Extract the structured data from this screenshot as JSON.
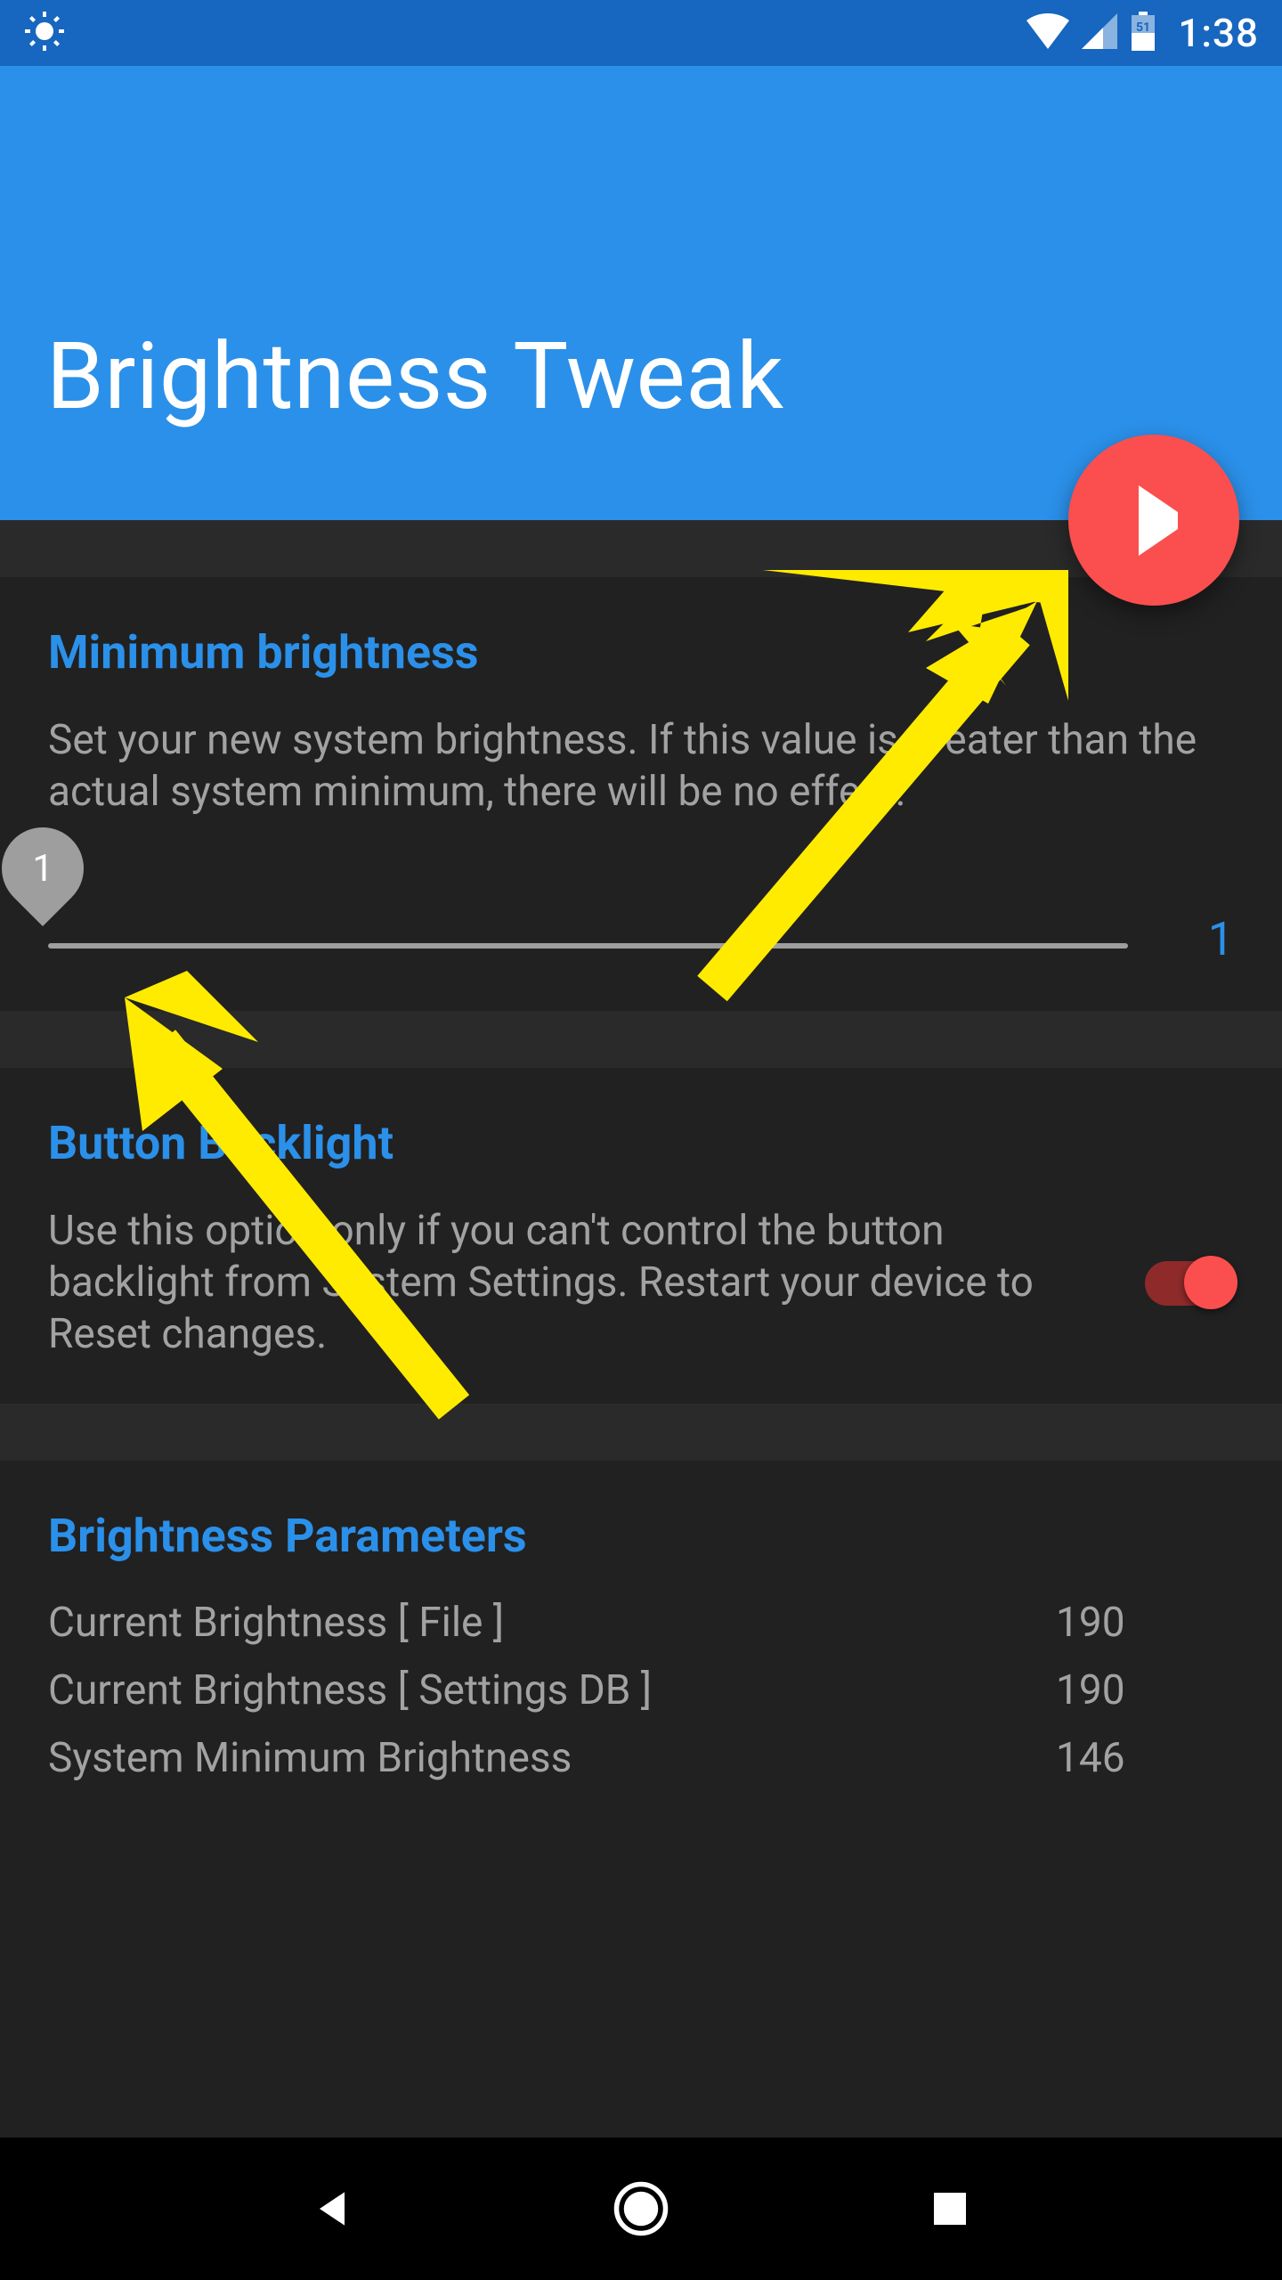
{
  "status_bar": {
    "battery_level": "51",
    "clock": "1:38"
  },
  "header": {
    "title": "Brightness Tweak"
  },
  "fab": {
    "icon": "play"
  },
  "cards": {
    "min_brightness": {
      "title": "Minimum brightness",
      "description": "Set your new system brightness. If this value is greater than the actual system minimum, there will be no effect.",
      "slider_pin": "1",
      "slider_value": "1"
    },
    "button_backlight": {
      "title": "Button Backlight",
      "description": "Use this option only if you can't control the button backlight from System Settings. Restart your device to Reset changes.",
      "switch_on": true
    },
    "params": {
      "title": "Brightness Parameters",
      "rows": [
        {
          "label": "Current Brightness [ File ]",
          "value": "190"
        },
        {
          "label": "Current Brightness [ Settings DB ]",
          "value": "190"
        },
        {
          "label": "System Minimum Brightness",
          "value": "146"
        }
      ]
    }
  },
  "colors": {
    "status_bar": "#1766BF",
    "header": "#2B90E9",
    "accent": "#2B90E9",
    "fab": "#FA4F4E",
    "card_bg": "#212121",
    "gap_bg": "#2A2A2A",
    "text_muted": "#A2A2A2",
    "annotation_arrow": "#FFEB00"
  }
}
